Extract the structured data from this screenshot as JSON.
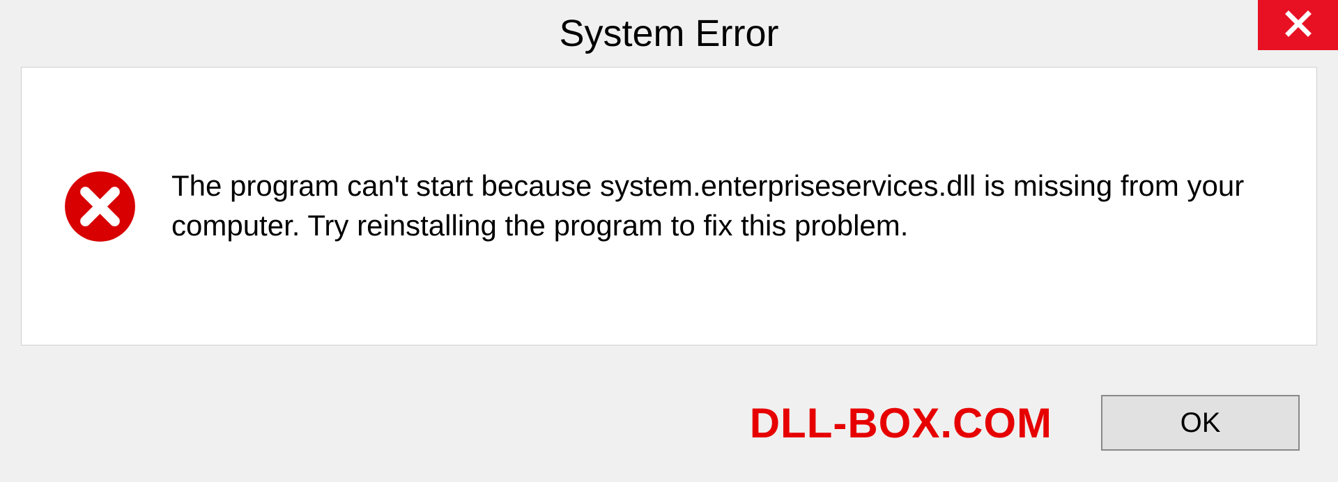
{
  "dialog": {
    "title": "System Error",
    "message": "The program can't start because system.enterpriseservices.dll is missing from your computer. Try reinstalling the program to fix this problem.",
    "ok_label": "OK"
  },
  "watermark": "DLL-BOX.COM",
  "colors": {
    "close_bg": "#e81123",
    "error_red": "#d80000",
    "watermark_red": "#e60000"
  }
}
